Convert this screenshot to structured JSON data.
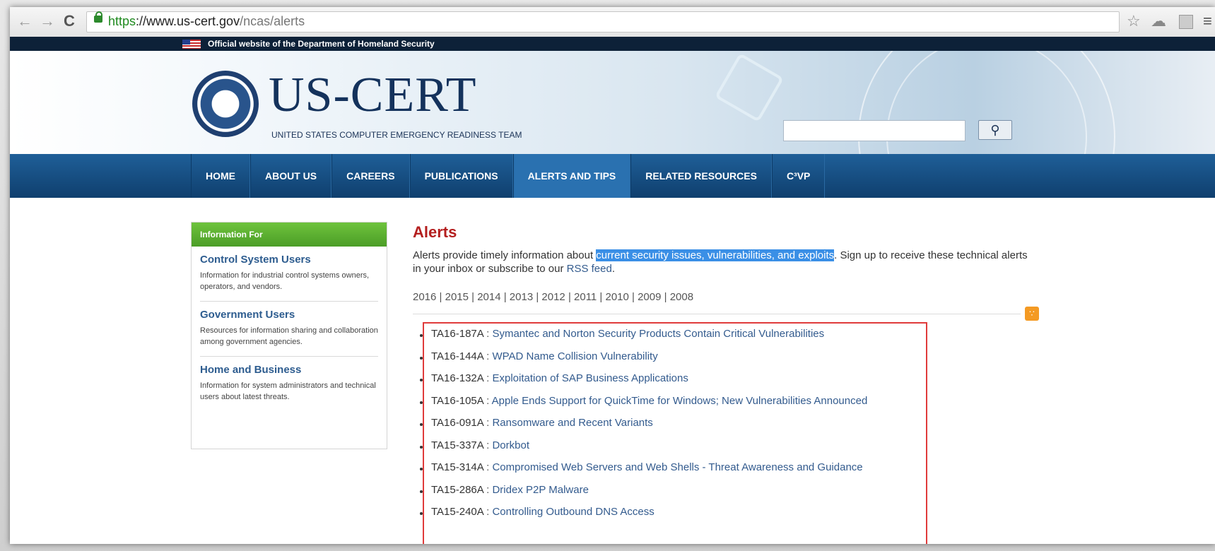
{
  "browser": {
    "url_scheme": "https",
    "url_host": "://www.us-cert.gov",
    "url_path": "/ncas/alerts"
  },
  "top_strip": {
    "text": "Official website of the Department of Homeland Security"
  },
  "header": {
    "title": "US-CERT",
    "subtitle": "UNITED STATES COMPUTER EMERGENCY READINESS TEAM",
    "search_placeholder": ""
  },
  "nav": {
    "items": [
      "HOME",
      "ABOUT US",
      "CAREERS",
      "PUBLICATIONS",
      "ALERTS AND TIPS",
      "RELATED RESOURCES",
      "C³VP"
    ],
    "active": "ALERTS AND TIPS"
  },
  "sidebar": {
    "heading": "Information For",
    "blocks": [
      {
        "title": "Control System Users",
        "desc": "Information for industrial control systems owners, operators, and vendors."
      },
      {
        "title": "Government Users",
        "desc": "Resources for information sharing and collaboration among government agencies."
      },
      {
        "title": "Home and Business",
        "desc": "Information for system administrators and technical users about latest threats."
      }
    ]
  },
  "main": {
    "heading": "Alerts",
    "intro_before": "Alerts provide timely information about ",
    "intro_highlight": "current security issues, vulnerabilities, and exploits",
    "intro_after": ". Sign up to receive these technical alerts in your inbox or subscribe to our ",
    "intro_link": "RSS feed",
    "intro_end": ".",
    "years": "2016 | 2015 | 2014 | 2013 | 2012 | 2011 | 2010 | 2009 | 2008",
    "alerts": [
      {
        "id": "TA16-187A",
        "title": "Symantec and Norton Security Products Contain Critical Vulnerabilities"
      },
      {
        "id": "TA16-144A",
        "title": "WPAD Name Collision Vulnerability"
      },
      {
        "id": "TA16-132A",
        "title": "Exploitation of SAP Business Applications"
      },
      {
        "id": "TA16-105A",
        "title": "Apple Ends Support for QuickTime for Windows; New Vulnerabilities Announced"
      },
      {
        "id": "TA16-091A",
        "title": "Ransomware and Recent Variants"
      },
      {
        "id": "TA15-337A",
        "title": "Dorkbot"
      },
      {
        "id": "TA15-314A",
        "title": "Compromised Web Servers and Web Shells - Threat Awareness and Guidance"
      },
      {
        "id": "TA15-286A",
        "title": "Dridex P2P Malware"
      },
      {
        "id": "TA15-240A",
        "title": "Controlling Outbound DNS Access"
      }
    ]
  },
  "colors": {
    "nav_bg": "#1f5f98",
    "alert_heading": "#b41e1e",
    "sidebar_head": "#4b9d26",
    "highlight_box": "#e03b3b",
    "link": "#335b8e"
  }
}
